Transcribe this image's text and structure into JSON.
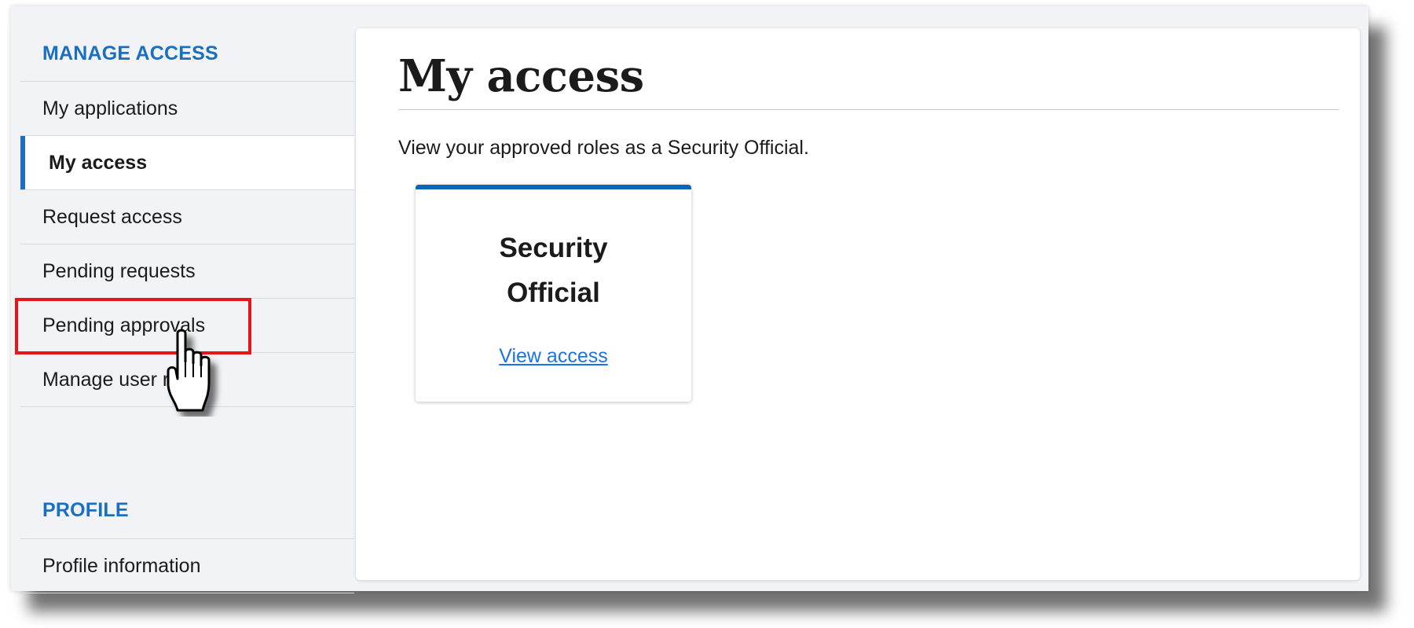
{
  "sidebar": {
    "sections": [
      {
        "heading": "MANAGE ACCESS",
        "items": [
          {
            "label": "My applications"
          },
          {
            "label": "My access"
          },
          {
            "label": "Request access"
          },
          {
            "label": "Pending requests"
          },
          {
            "label": "Pending approvals"
          },
          {
            "label": "Manage user r"
          }
        ]
      },
      {
        "heading": "PROFILE",
        "items": [
          {
            "label": "Profile information"
          }
        ]
      }
    ],
    "active_item": "My access",
    "highlighted_item": "Pending approvals"
  },
  "main": {
    "title": "My access",
    "subtitle": "View your approved roles as a Security Official.",
    "role_cards": [
      {
        "title": "Security Official",
        "link_label": "View access"
      }
    ]
  },
  "colors": {
    "accent": "#1a6fc0",
    "card_top_border": "#0a66b7",
    "link": "#1a73e8",
    "highlight": "#e8141b"
  },
  "icons": {
    "cursor": "hand-pointer-icon"
  }
}
